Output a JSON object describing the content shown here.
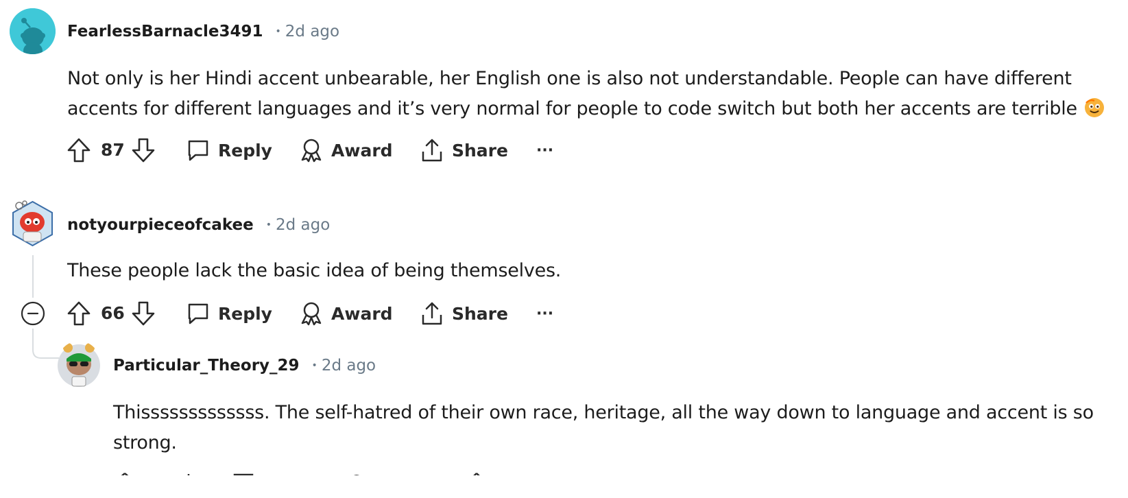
{
  "comments": [
    {
      "username": "FearlessBarnacle3491",
      "dot": "•",
      "time": "2d ago",
      "text_line1": "Not only is her Hindi accent unbearable, her English one is also not understandable. People can have different",
      "text_line2": "accents for different languages and it’s very normal for people to code switch but both her accents are terrible",
      "votes": "87",
      "reply_label": "Reply",
      "award_label": "Award",
      "share_label": "Share",
      "more_label": "···",
      "avatar_color": "#3fc8d8"
    },
    {
      "username": "notyourpieceofcakee",
      "dot": "•",
      "time": "2d ago",
      "text_line1": "These people lack the basic idea of being themselves.",
      "votes": "66",
      "reply_label": "Reply",
      "award_label": "Award",
      "share_label": "Share",
      "more_label": "···",
      "avatar_color": "#e23b2e"
    },
    {
      "username": "Particular_Theory_29",
      "dot": "•",
      "time": "2d ago",
      "text_line1": "Thisssssssssssss. The self-hatred of their own race, heritage, all the way down to language and accent is so",
      "text_line2": "strong.",
      "avatar_color": "#d9dde2"
    }
  ],
  "icons": {
    "upvote": "arrow-up-icon",
    "downvote": "arrow-down-icon",
    "reply": "speech-bubble-icon",
    "award": "award-ribbon-icon",
    "share": "share-arrow-icon",
    "collapse": "minus-circle-icon"
  },
  "colors": {
    "text": "#1c1c1c",
    "meta": "#6a7a88",
    "thread_line": "#d9dde0"
  }
}
